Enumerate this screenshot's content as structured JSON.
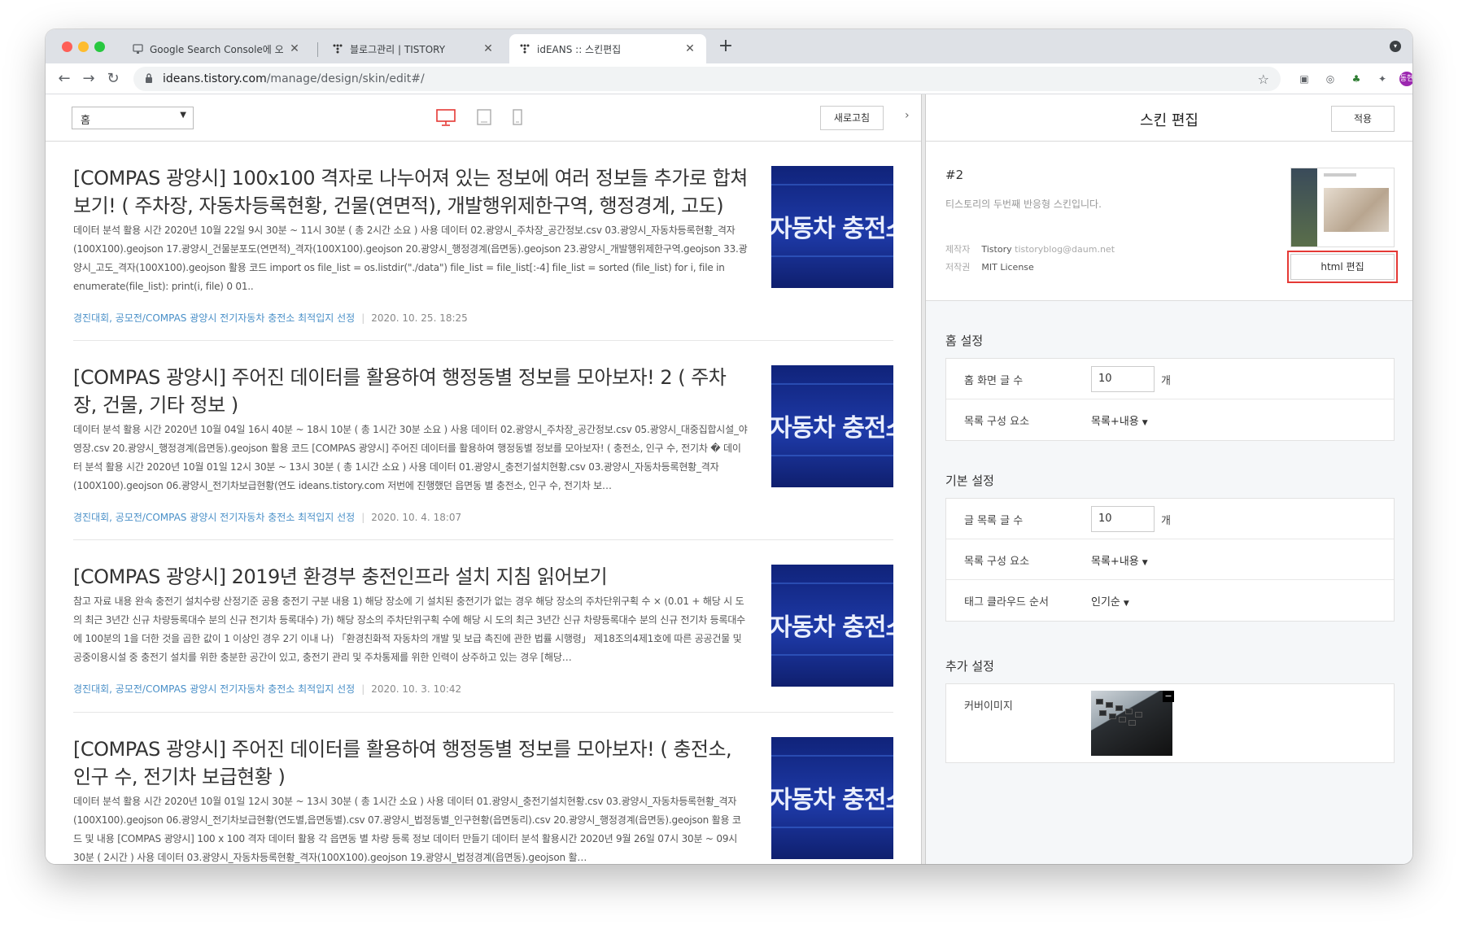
{
  "browser": {
    "tabs": [
      {
        "title": "Google Search Console에 오신",
        "icon": "search-console-icon"
      },
      {
        "title": "블로그관리 | TISTORY",
        "icon": "tistory-icon"
      },
      {
        "title": "idEANS :: 스킨편집",
        "icon": "tistory-icon"
      }
    ],
    "url_host": "ideans.tistory.com",
    "url_path": "/manage/design/skin/edit#/",
    "profile_label": "동현"
  },
  "preview": {
    "page_select": "홈",
    "refresh_label": "새로고침",
    "posts": [
      {
        "title": "[COMPAS 광양시] 100x100 격자로 나누어져 있는 정보에 여러 정보들 추가로 합쳐보기! ( 주차장, 자동차등록현황, 건물(연면적), 개발행위제한구역, 행정경계, 고도)",
        "body": "데이터 분석 활용 시간 2020년 10월 22일 9시 30분 ~ 11시 30분 ( 총 2시간 소요 ) 사용 데이터 02.광양시_주차장_공간정보.csv 03.광양시_자동차등록현황_격자(100X100).geojson 17.광양시_건물분포도(연면적)_격자(100X100).geojson 20.광양시_행정경계(읍면동).geojson 23.광양시_개발행위제한구역.geojson 33.광양시_고도_격자(100X100).geojson 활용 코드 import os file_list = os.listdir(\"./data\") file_list = file_list[:-4] file_list = sorted (file_list) for i, file in enumerate(file_list): print(i, file) 0 01..",
        "category": "경진대회, 공모전/COMPAS 광양시 전기자동차 충전소 최적입지 선정",
        "date": "2020. 10. 25. 18:25",
        "thumb_text": "자동차 충전소"
      },
      {
        "title": "[COMPAS 광양시] 주어진 데이터를 활용하여 행정동별 정보를 모아보자! 2 ( 주차장, 건물, 기타 정보 )",
        "body": "데이터 분석 활용 시간 2020년 10월 04일 16시 40분 ~ 18시 10분 ( 총 1시간 30분 소요 ) 사용 데이터 02.광양시_주차장_공간정보.csv 05.광양시_대중집합시설_야영장.csv 20.광양시_행정경계(읍면동).geojson 활용 코드 [COMPAS 광양시] 주어진 데이터를 활용하여 행정동별 정보를 모아보자! ( 충전소, 인구 수, 전기차 � 데이터 분석 활용 시간 2020년 10월 01일 12시 30분 ~ 13시 30분 ( 총 1시간 소요 ) 사용 데이터 01.광양시_충전기설치현황.csv 03.광양시_자동차등록현황_격자(100X100).geojson 06.광양시_전기차보급현황(연도 ideans.tistory.com 저번에 진행했던 읍면동 별 충전소, 인구 수, 전기차 보…",
        "category": "경진대회, 공모전/COMPAS 광양시 전기자동차 충전소 최적입지 선정",
        "date": "2020. 10. 4. 18:07",
        "thumb_text": "자동차 충전소"
      },
      {
        "title": "[COMPAS 광양시] 2019년 환경부 충전인프라 설치 지침 읽어보기",
        "body": "참고 자료 내용 완속 충전기 설치수량 산정기준 공용 충전기 구분 내용 1) 해당 장소에 기 설치된 충전기가 없는 경우 해당 장소의 주차단위구획 수 × (0.01 + 해당 시 도의 최근 3년간 신규 차량등록대수 분의 신규 전기차 등록대수) 가) 해당 장소의 주차단위구획 수에 해당 시 도의 최근 3년간 신규 차량등록대수 분의 신규 전기차 등록대수에 100분의 1을 더한 것을 곱한 값이 1 이상인 경우 2기 이내 나) 「환경친화적 자동차의 개발 및 보급 촉진에 관한 법률 시행령」 제18조의4제1호에 따른 공공건물 및 공중이용시설 중 충전기 설치를 위한 충분한 공간이 있고, 충전기 관리 및 주차통제를 위한 인력이 상주하고 있는 경우 [해당…",
        "category": "경진대회, 공모전/COMPAS 광양시 전기자동차 충전소 최적입지 선정",
        "date": "2020. 10. 3. 10:42",
        "thumb_text": "자동차 충전소"
      },
      {
        "title": "[COMPAS 광양시] 주어진 데이터를 활용하여 행정동별 정보를 모아보자! ( 충전소, 인구 수, 전기차 보급현황 )",
        "body": "데이터 분석 활용 시간 2020년 10월 01일 12시 30분 ~ 13시 30분 ( 총 1시간 소요 ) 사용 데이터 01.광양시_충전기설치현황.csv 03.광양시_자동차등록현황_격자(100X100).geojson 06.광양시_전기차보급현황(연도별,읍면동별).csv 07.광양시_법정동별_인구현황(읍면동리).csv 20.광양시_행정경계(읍면동).geojson 활용 코드 및 내용 [COMPAS 광양시] 100 x 100 격자 데이터 활용 각 읍면동 별 차량 등록 정보 데이터 만들기 데이터 분석 활용시간 2020년 9월 26일 07시 30분 ~ 09시 30분 ( 2시간 ) 사용 데이터 03.광양시_자동차등록현황_격자(100X100).geojson 19.광양시_법정경계(읍면동).geojson 활…",
        "category": "경진대회, 공모전/COMPAS 광양시 전기자동차 충전소 최적입지 선정",
        "date": "",
        "thumb_text": "자동차 충전소"
      }
    ]
  },
  "panel": {
    "title": "스킨 편집",
    "apply_label": "적용",
    "skin": {
      "number": "#2",
      "description": "티스토리의 두번째 반응형 스킨입니다.",
      "maker_label": "제작자",
      "maker_name": "Tistory",
      "maker_email": "tistoryblog@daum.net",
      "license_label": "저작권",
      "license_value": "MIT License",
      "html_edit_label": "html 편집"
    },
    "home_settings": {
      "title": "홈 설정",
      "rows": [
        {
          "label": "홈 화면 글 수",
          "value": "10",
          "unit": "개"
        },
        {
          "label": "목록 구성 요소",
          "value": "목록+내용"
        }
      ]
    },
    "basic_settings": {
      "title": "기본 설정",
      "rows": [
        {
          "label": "글 목록 글 수",
          "value": "10",
          "unit": "개"
        },
        {
          "label": "목록 구성 요소",
          "value": "목록+내용"
        },
        {
          "label": "태그 클라우드 순서",
          "value": "인기순"
        }
      ]
    },
    "extra_settings": {
      "title": "추가 설정",
      "cover_label": "커버이미지"
    }
  },
  "colors": {
    "highlight": "#e53935",
    "category_link": "#4a90c8",
    "thumb_blue": "#1e3aa8"
  }
}
